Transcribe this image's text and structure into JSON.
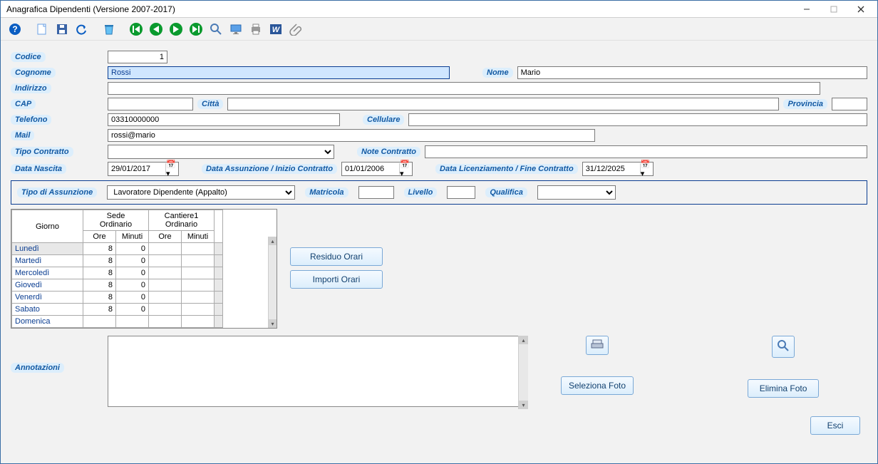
{
  "window": {
    "title": "Anagrafica Dipendenti (Versione 2007-2017)"
  },
  "toolbar": {
    "icons": [
      "help",
      "new",
      "save",
      "undo",
      "delete",
      "nav-first",
      "nav-prev",
      "nav-next",
      "nav-last",
      "search",
      "screen",
      "print",
      "word",
      "attach"
    ]
  },
  "labels": {
    "codice": "Codice",
    "cognome": "Cognome",
    "nome": "Nome",
    "indirizzo": "Indirizzo",
    "cap": "CAP",
    "citta": "Città",
    "provincia": "Provincia",
    "telefono": "Telefono",
    "cellulare": "Cellulare",
    "mail": "Mail",
    "tipo_contratto": "Tipo Contratto",
    "note_contratto": "Note Contratto",
    "data_nascita": "Data Nascita",
    "data_assunzione": "Data Assunzione / Inizio Contratto",
    "data_licenziamento": "Data Licenziamento / Fine Contratto",
    "tipo_assunzione": "Tipo di Assunzione",
    "matricola": "Matricola",
    "livello": "Livello",
    "qualifica": "Qualifica",
    "annotazioni": "Annotazioni"
  },
  "fields": {
    "codice": "1",
    "cognome": "Rossi",
    "nome": "Mario",
    "indirizzo": "",
    "cap": "",
    "citta": "",
    "provincia": "",
    "telefono": "03310000000",
    "cellulare": "",
    "mail": "rossi@mario",
    "tipo_contratto": "",
    "note_contratto": "",
    "data_nascita": "29/01/2017",
    "data_assunzione": "01/01/2006",
    "data_licenziamento": "31/12/2025",
    "tipo_assunzione": "Lavoratore Dipendente (Appalto)",
    "matricola": "",
    "livello": "",
    "qualifica": "",
    "annotazioni": ""
  },
  "grid": {
    "col_giorno": "Giorno",
    "col_sede": "Sede\nOrdinario",
    "col_cantiere": "Cantiere1\nOrdinario",
    "col_ore": "Ore",
    "col_minuti": "Minuti",
    "rows": [
      {
        "day": "Lunedì",
        "ore1": "8",
        "min1": "0",
        "ore2": "",
        "min2": ""
      },
      {
        "day": "Martedì",
        "ore1": "8",
        "min1": "0",
        "ore2": "",
        "min2": ""
      },
      {
        "day": "Mercoledì",
        "ore1": "8",
        "min1": "0",
        "ore2": "",
        "min2": ""
      },
      {
        "day": "Giovedì",
        "ore1": "8",
        "min1": "0",
        "ore2": "",
        "min2": ""
      },
      {
        "day": "Venerdì",
        "ore1": "8",
        "min1": "0",
        "ore2": "",
        "min2": ""
      },
      {
        "day": "Sabato",
        "ore1": "8",
        "min1": "0",
        "ore2": "",
        "min2": ""
      },
      {
        "day": "Domenica",
        "ore1": "",
        "min1": "",
        "ore2": "",
        "min2": ""
      }
    ]
  },
  "buttons": {
    "residuo": "Residuo Orari",
    "importi": "Importi Orari",
    "seleziona_foto": "Seleziona Foto",
    "elimina_foto": "Elimina Foto",
    "esci": "Esci"
  }
}
